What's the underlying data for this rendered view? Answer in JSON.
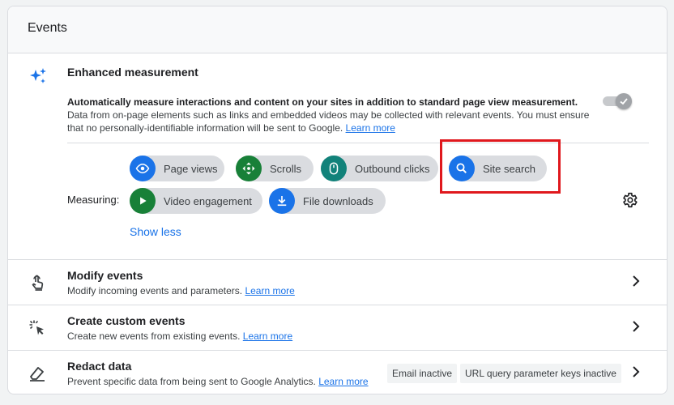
{
  "header": {
    "title": "Events"
  },
  "enhanced_measurement": {
    "title": "Enhanced measurement",
    "desc_bold": "Automatically measure interactions and content on your sites in addition to standard page view measurement.",
    "desc_rest": "Data from on-page elements such as links and embedded videos may be collected with relevant events. You must ensure that no personally-identifiable information will be sent to Google.",
    "learn_more": "Learn more",
    "toggle_on": true,
    "measuring_label": "Measuring:",
    "chips": [
      {
        "label": "Page views",
        "icon": "eye-icon",
        "color": "#1a73e8"
      },
      {
        "label": "Scrolls",
        "icon": "arrows-icon",
        "color": "#188038"
      },
      {
        "label": "Outbound clicks",
        "icon": "mouse-icon",
        "color": "#12827a"
      },
      {
        "label": "Site search",
        "icon": "search-icon",
        "color": "#1a73e8"
      },
      {
        "label": "Video engagement",
        "icon": "play-icon",
        "color": "#188038"
      },
      {
        "label": "File downloads",
        "icon": "download-icon",
        "color": "#1a73e8"
      }
    ],
    "show_less": "Show less",
    "settings_icon": "gear-icon",
    "highlight_color": "#e0181d"
  },
  "rows": [
    {
      "title": "Modify events",
      "desc": "Modify incoming events and parameters.",
      "learn_more": "Learn more",
      "icon": "touch-icon"
    },
    {
      "title": "Create custom events",
      "desc": "Create new events from existing events.",
      "learn_more": "Learn more",
      "icon": "click-sparkle-icon"
    },
    {
      "title": "Redact data",
      "desc": "Prevent specific data from being sent to Google Analytics.",
      "learn_more": "Learn more",
      "icon": "eraser-icon",
      "tags": [
        "Email inactive",
        "URL query parameter keys inactive"
      ]
    }
  ]
}
